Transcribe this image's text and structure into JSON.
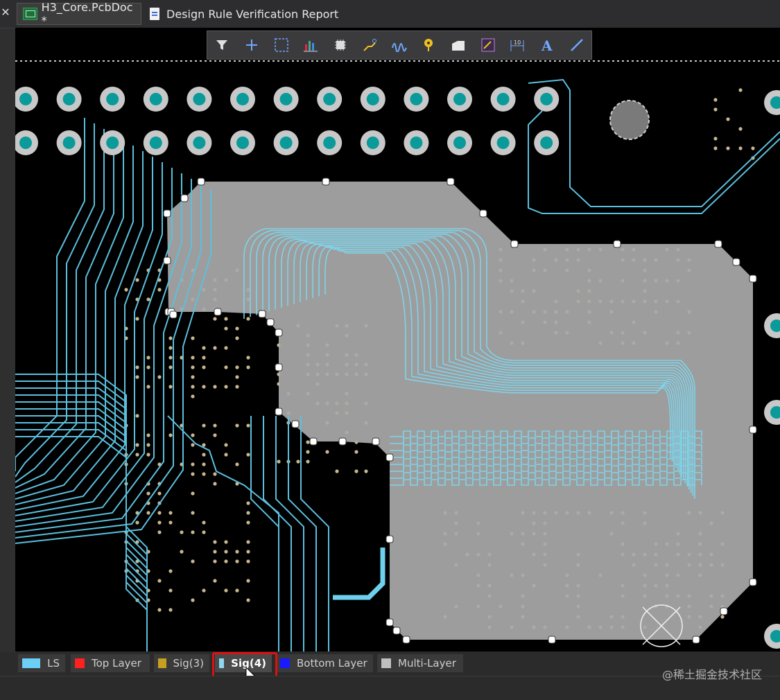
{
  "tabs": [
    {
      "label": "H3_Core.PcbDoc *",
      "active": true
    },
    {
      "label": "Design Rule Verification Report",
      "active": false
    }
  ],
  "toolbar": {
    "tools": [
      "filter-icon",
      "cross-probe-icon",
      "select-rect-icon",
      "chart-icon",
      "component-icon",
      "route-icon",
      "interactive-length-icon",
      "place-via-icon",
      "region-icon",
      "place-polygon-icon",
      "dimension-icon",
      "text-icon",
      "line-icon"
    ]
  },
  "layers": [
    {
      "label": "LS",
      "color": "#6ccff6"
    },
    {
      "label": "Top Layer",
      "color": "#ff2020"
    },
    {
      "label": "Sig(3)",
      "color": "#c8a020"
    },
    {
      "label": "Sig(4)",
      "color": "#8fd9f0"
    },
    {
      "label": "Bottom Layer",
      "color": "#1a1aff"
    },
    {
      "label": "Multi-Layer",
      "color": "#c0c0c0"
    }
  ],
  "watermark": "@稀土掘金技术社区",
  "colors": {
    "trace": "#5bc0de",
    "copper_pour": "#a0a0a0",
    "pad_ring": "#c8c8c8",
    "pad_center": "#0a9a9a",
    "via": "#c8b890"
  }
}
